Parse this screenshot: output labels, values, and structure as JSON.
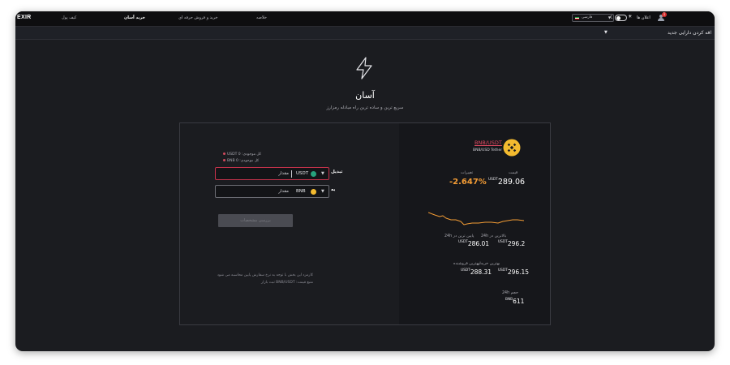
{
  "topbar": {
    "logo": "EXIR",
    "nav": [
      "کیف پول",
      "خرید آسان",
      "خرید و فروش حرفه ای",
      "خلاصه"
    ],
    "language": "فارسی",
    "notifications": "اعلان ها",
    "notification_count": "1"
  },
  "subbar": {
    "add_asset": "افه کردن دارایی جدید"
  },
  "hero": {
    "icon": "lightning-bolt-icon",
    "title": "آسان",
    "subtitle": "سریع ترین و ساده ترین راه مبادله رمزارز"
  },
  "trade": {
    "balance_usdt": "USDT کل موجودی: 0",
    "balance_bnb": "BNB کل موجودی: 0",
    "from_label": "تبدیل",
    "to_label": "به",
    "from_currency": "USDT",
    "to_currency": "BNB",
    "amount_placeholder": "مقدار",
    "submit_label": "بررسی مشخصات",
    "note_lines": [
      "کارمزد این بخش با توجه به نرخ سفارش پایین محاسبه می شود",
      "منبع قیمت: BNB/USDT ثبت بازار"
    ]
  },
  "market": {
    "pair_link": "BNB/USDT",
    "pair_subtitle": "BNB/USD Tether",
    "price_label": "قیمت",
    "price_value": "289.06",
    "price_unit": "USDT",
    "change_label": "تغییرات",
    "change_value": "-2.647%",
    "high24_label": "بالاترین در 24h",
    "high24_value": "296.2",
    "high24_unit": "USDT",
    "low24_label": "پایین ترین در 24h",
    "low24_value": "286.01",
    "low24_unit": "USDT",
    "best_buy_label": "بهترین خریدار",
    "best_buy_value": "288.31",
    "best_buy_unit": "USDT",
    "best_sell_label": "بهترین فروشنده",
    "best_sell_value": "296.15",
    "best_sell_unit": "USDT",
    "volume_label": "حجم 24h",
    "volume_value": "611",
    "volume_unit": "BNB"
  },
  "colors": {
    "accent": "#c2324a",
    "change": "#f39c35",
    "bnb": "#f3ba2f",
    "usdt": "#26a17b"
  }
}
